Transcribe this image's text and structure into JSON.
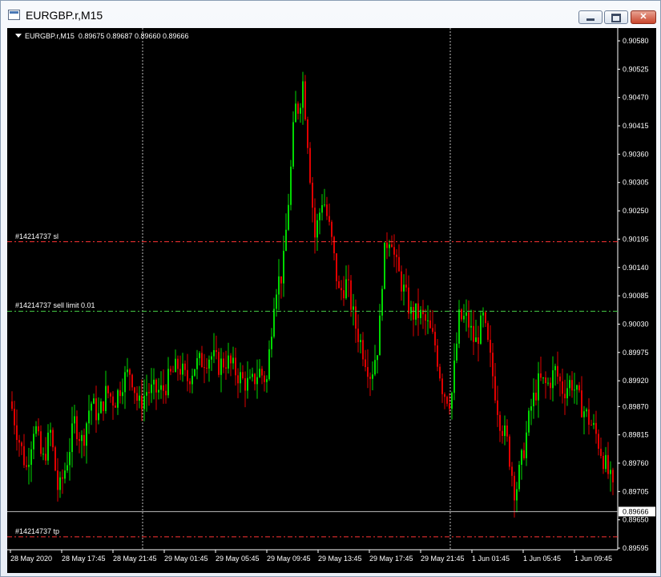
{
  "window": {
    "title": "EURGBP.r,M15"
  },
  "controls": {
    "minimize": "minimize",
    "maximize": "maximize",
    "close": "close"
  },
  "chart_header": {
    "symbol": "EURGBP.r,M15",
    "ohlc": "0.89675 0.89687 0.89660 0.89666"
  },
  "colors": {
    "up": "#00d800",
    "down": "#e00000",
    "background": "#000000",
    "sl_tp": "#ff3333",
    "order": "#44cc44"
  },
  "orders": [
    {
      "label": "#14214737 sl",
      "price": 0.9019
    },
    {
      "label": "#14214737 sell limit 0.01",
      "price": 0.90055
    },
    {
      "label": "#14214737 tp",
      "price": 0.89617
    }
  ],
  "chart_data": {
    "type": "candlestick",
    "ylim": [
      0.89595,
      0.9058
    ],
    "y_ticks": [
      "0.90580",
      "0.90525",
      "0.90470",
      "0.90415",
      "0.90360",
      "0.90305",
      "0.90250",
      "0.90195",
      "0.90140",
      "0.90085",
      "0.90030",
      "0.89975",
      "0.89920",
      "0.89870",
      "0.89815",
      "0.89760",
      "0.89705",
      "0.89650",
      "0.89595"
    ],
    "x_ticks": [
      "28 May 2020",
      "28 May 17:45",
      "28 May 21:45",
      "29 May 01:45",
      "29 May 05:45",
      "29 May 09:45",
      "29 May 13:45",
      "29 May 17:45",
      "29 May 21:45",
      "1 Jun 01:45",
      "1 Jun 05:45",
      "1 Jun 09:45"
    ],
    "current_price": "0.89666",
    "bid_line": 0.89666,
    "session_separators": [
      "28 May 21:45",
      "29 May 21:45"
    ],
    "close_path": [
      [
        0,
        0.8988
      ],
      [
        10,
        0.8981
      ],
      [
        20,
        0.8975
      ],
      [
        30,
        0.8984
      ],
      [
        40,
        0.8976
      ],
      [
        50,
        0.8982
      ],
      [
        60,
        0.897
      ],
      [
        70,
        0.8976
      ],
      [
        80,
        0.8984
      ],
      [
        90,
        0.898
      ],
      [
        100,
        0.8988
      ],
      [
        110,
        0.8985
      ],
      [
        120,
        0.899
      ],
      [
        130,
        0.8988
      ],
      [
        140,
        0.8992
      ],
      [
        150,
        0.8994
      ],
      [
        160,
        0.8987
      ],
      [
        170,
        0.899
      ],
      [
        180,
        0.899
      ],
      [
        190,
        0.899
      ],
      [
        200,
        0.8993
      ],
      [
        210,
        0.8995
      ],
      [
        220,
        0.8992
      ],
      [
        230,
        0.8995
      ],
      [
        240,
        0.8996
      ],
      [
        250,
        0.8997
      ],
      [
        260,
        0.8995
      ],
      [
        270,
        0.8996
      ],
      [
        280,
        0.8994
      ],
      [
        290,
        0.8992
      ],
      [
        300,
        0.8991
      ],
      [
        310,
        0.8994
      ],
      [
        320,
        0.8992
      ],
      [
        330,
        0.901
      ],
      [
        340,
        0.9013
      ],
      [
        350,
        0.9033
      ],
      [
        355,
        0.9045
      ],
      [
        360,
        0.9045
      ],
      [
        365,
        0.905
      ],
      [
        370,
        0.9041
      ],
      [
        375,
        0.903
      ],
      [
        380,
        0.902
      ],
      [
        390,
        0.9028
      ],
      [
        400,
        0.902
      ],
      [
        410,
        0.9009
      ],
      [
        420,
        0.9011
      ],
      [
        430,
        0.9003
      ],
      [
        440,
        0.8998
      ],
      [
        450,
        0.8993
      ],
      [
        460,
        0.9
      ],
      [
        465,
        0.9015
      ],
      [
        470,
        0.9019
      ],
      [
        475,
        0.9021
      ],
      [
        480,
        0.9015
      ],
      [
        490,
        0.901
      ],
      [
        500,
        0.9005
      ],
      [
        510,
        0.9005
      ],
      [
        520,
        0.9003
      ],
      [
        530,
        0.8999
      ],
      [
        540,
        0.899
      ],
      [
        550,
        0.8988
      ],
      [
        560,
        0.9004
      ],
      [
        570,
        0.9004
      ],
      [
        580,
        0.8999
      ],
      [
        590,
        0.9004
      ],
      [
        600,
        0.8995
      ],
      [
        610,
        0.8985
      ],
      [
        620,
        0.898
      ],
      [
        630,
        0.897
      ],
      [
        640,
        0.8978
      ],
      [
        650,
        0.8987
      ],
      [
        660,
        0.8992
      ],
      [
        670,
        0.8991
      ],
      [
        680,
        0.8994
      ],
      [
        690,
        0.899
      ],
      [
        700,
        0.8992
      ],
      [
        710,
        0.8988
      ],
      [
        720,
        0.8985
      ],
      [
        730,
        0.8982
      ],
      [
        740,
        0.8977
      ],
      [
        750,
        0.8972
      ],
      [
        755,
        0.8968
      ],
      [
        761,
        0.89666
      ]
    ]
  }
}
